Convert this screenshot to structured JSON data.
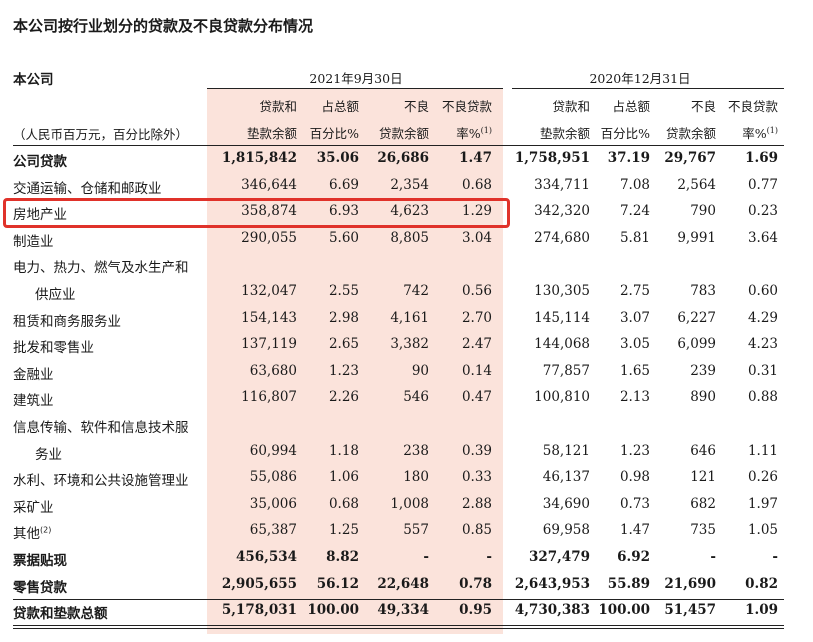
{
  "title": "本公司按行业划分的贷款及不良贷款分布情况",
  "entity_label": "本公司",
  "unit_note": "（人民币百万元，百分比除外）",
  "periods": [
    "2021年9月30日",
    "2020年12月31日"
  ],
  "col_headers": [
    {
      "line1": "贷款和",
      "line2": "垫款余额"
    },
    {
      "line1": "占总额",
      "line2": "百分比%"
    },
    {
      "line1": "不良",
      "line2": "贷款余额"
    },
    {
      "line1": "不良贷款",
      "line2": "率%",
      "sup": "(1)"
    },
    {
      "line1": "贷款和",
      "line2": "垫款余额"
    },
    {
      "line1": "占总额",
      "line2": "百分比%"
    },
    {
      "line1": "不良",
      "line2": "贷款余额"
    },
    {
      "line1": "不良贷款",
      "line2": "率%",
      "sup": "(1)"
    }
  ],
  "rows": [
    {
      "label": "公司贷款",
      "bold": true,
      "values": [
        "1,815,842",
        "35.06",
        "26,686",
        "1.47",
        "1,758,951",
        "37.19",
        "29,767",
        "1.69"
      ]
    },
    {
      "label": "交通运输、仓储和邮政业",
      "values": [
        "346,644",
        "6.69",
        "2,354",
        "0.68",
        "334,711",
        "7.08",
        "2,564",
        "0.77"
      ]
    },
    {
      "label": "房地产业",
      "values": [
        "358,874",
        "6.93",
        "4,623",
        "1.29",
        "342,320",
        "7.24",
        "790",
        "0.23"
      ]
    },
    {
      "label": "制造业",
      "values": [
        "290,055",
        "5.60",
        "8,805",
        "3.04",
        "274,680",
        "5.81",
        "9,991",
        "3.64"
      ]
    },
    {
      "label": "电力、热力、燃气及水生产和",
      "values": [
        "",
        "",
        "",
        "",
        "",
        "",
        "",
        ""
      ]
    },
    {
      "label": "供应业",
      "indent": true,
      "values": [
        "132,047",
        "2.55",
        "742",
        "0.56",
        "130,305",
        "2.75",
        "783",
        "0.60"
      ]
    },
    {
      "label": "租赁和商务服务业",
      "values": [
        "154,143",
        "2.98",
        "4,161",
        "2.70",
        "145,114",
        "3.07",
        "6,227",
        "4.29"
      ]
    },
    {
      "label": "批发和零售业",
      "values": [
        "137,119",
        "2.65",
        "3,382",
        "2.47",
        "144,068",
        "3.05",
        "6,099",
        "4.23"
      ]
    },
    {
      "label": "金融业",
      "values": [
        "63,680",
        "1.23",
        "90",
        "0.14",
        "77,857",
        "1.65",
        "239",
        "0.31"
      ]
    },
    {
      "label": "建筑业",
      "values": [
        "116,807",
        "2.26",
        "546",
        "0.47",
        "100,810",
        "2.13",
        "890",
        "0.88"
      ]
    },
    {
      "label": "信息传输、软件和信息技术服",
      "values": [
        "",
        "",
        "",
        "",
        "",
        "",
        "",
        ""
      ]
    },
    {
      "label": "务业",
      "indent": true,
      "values": [
        "60,994",
        "1.18",
        "238",
        "0.39",
        "58,121",
        "1.23",
        "646",
        "1.11"
      ]
    },
    {
      "label": "水利、环境和公共设施管理业",
      "values": [
        "55,086",
        "1.06",
        "180",
        "0.33",
        "46,137",
        "0.98",
        "121",
        "0.26"
      ]
    },
    {
      "label": "采矿业",
      "values": [
        "35,006",
        "0.68",
        "1,008",
        "2.88",
        "34,690",
        "0.73",
        "682",
        "1.97"
      ]
    },
    {
      "label": "其他",
      "sup": "(2)",
      "values": [
        "65,387",
        "1.25",
        "557",
        "0.85",
        "69,958",
        "1.47",
        "735",
        "1.05"
      ]
    },
    {
      "label": "票据贴现",
      "bold": true,
      "values": [
        "456,534",
        "8.82",
        "-",
        "-",
        "327,479",
        "6.92",
        "-",
        "-"
      ]
    },
    {
      "label": "零售贷款",
      "bold": true,
      "values": [
        "2,905,655",
        "56.12",
        "22,648",
        "0.78",
        "2,643,953",
        "55.89",
        "21,690",
        "0.82"
      ]
    },
    {
      "label": "贷款和垫款总额",
      "bold": true,
      "values": [
        "5,178,031",
        "100.00",
        "49,334",
        "0.95",
        "4,730,383",
        "100.00",
        "51,457",
        "1.09"
      ]
    }
  ],
  "highlight_color": "#e0322a",
  "column_shade": "#fbe3db"
}
